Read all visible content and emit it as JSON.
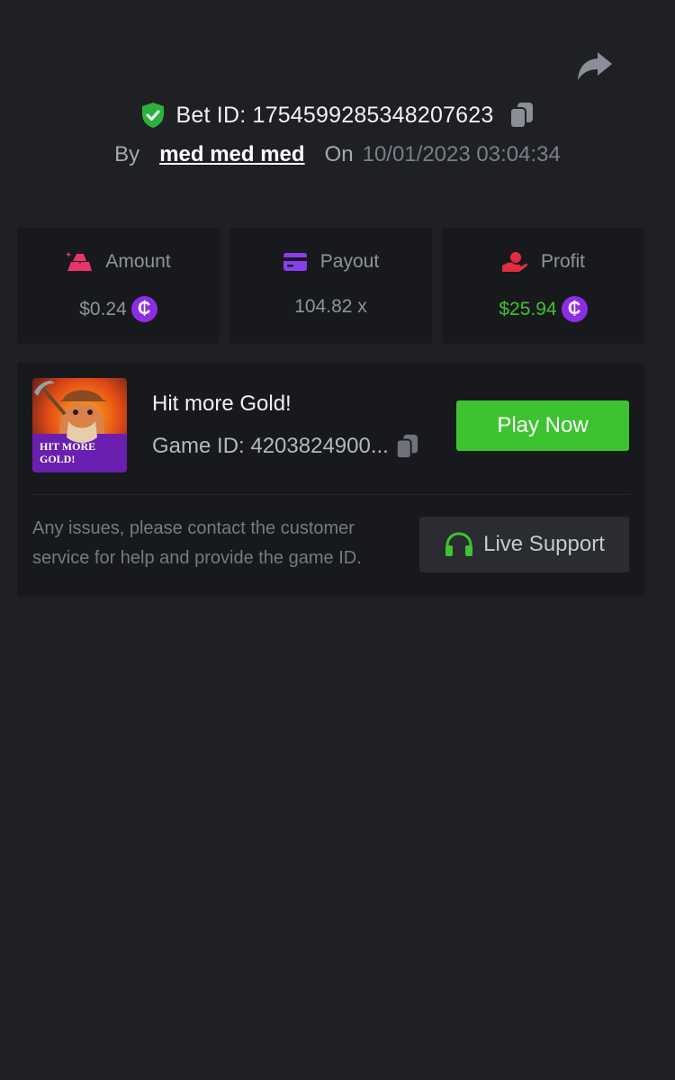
{
  "header": {
    "bet_id": "Bet ID: 1754599285348207623",
    "by_label": "By",
    "username": "med med med",
    "on_label": "On",
    "datetime": "10/01/2023 03:04:34"
  },
  "stats": {
    "amount": {
      "label": "Amount",
      "value": "$0.24",
      "icon": "gold-bars-icon"
    },
    "payout": {
      "label": "Payout",
      "value": "104.82 x",
      "icon": "credit-card-icon"
    },
    "profit": {
      "label": "Profit",
      "value": "$25.94",
      "icon": "hand-coin-icon"
    },
    "coin_symbol": "₵"
  },
  "game": {
    "title": "Hit more Gold!",
    "game_id": "Game ID: 4203824900...",
    "thumb_text_line1": "HIT MORE",
    "thumb_text_line2": "GOLD!",
    "play_label": "Play Now"
  },
  "support": {
    "help_text": "Any issues, please contact the customer service for help and provide the game ID.",
    "button_label": "Live Support"
  },
  "colors": {
    "accent_green": "#3ec330",
    "coin_purple": "#8c2de6",
    "amount_pink": "#e8356d",
    "payout_purple": "#8a3df0",
    "profit_red": "#e02e3e"
  }
}
